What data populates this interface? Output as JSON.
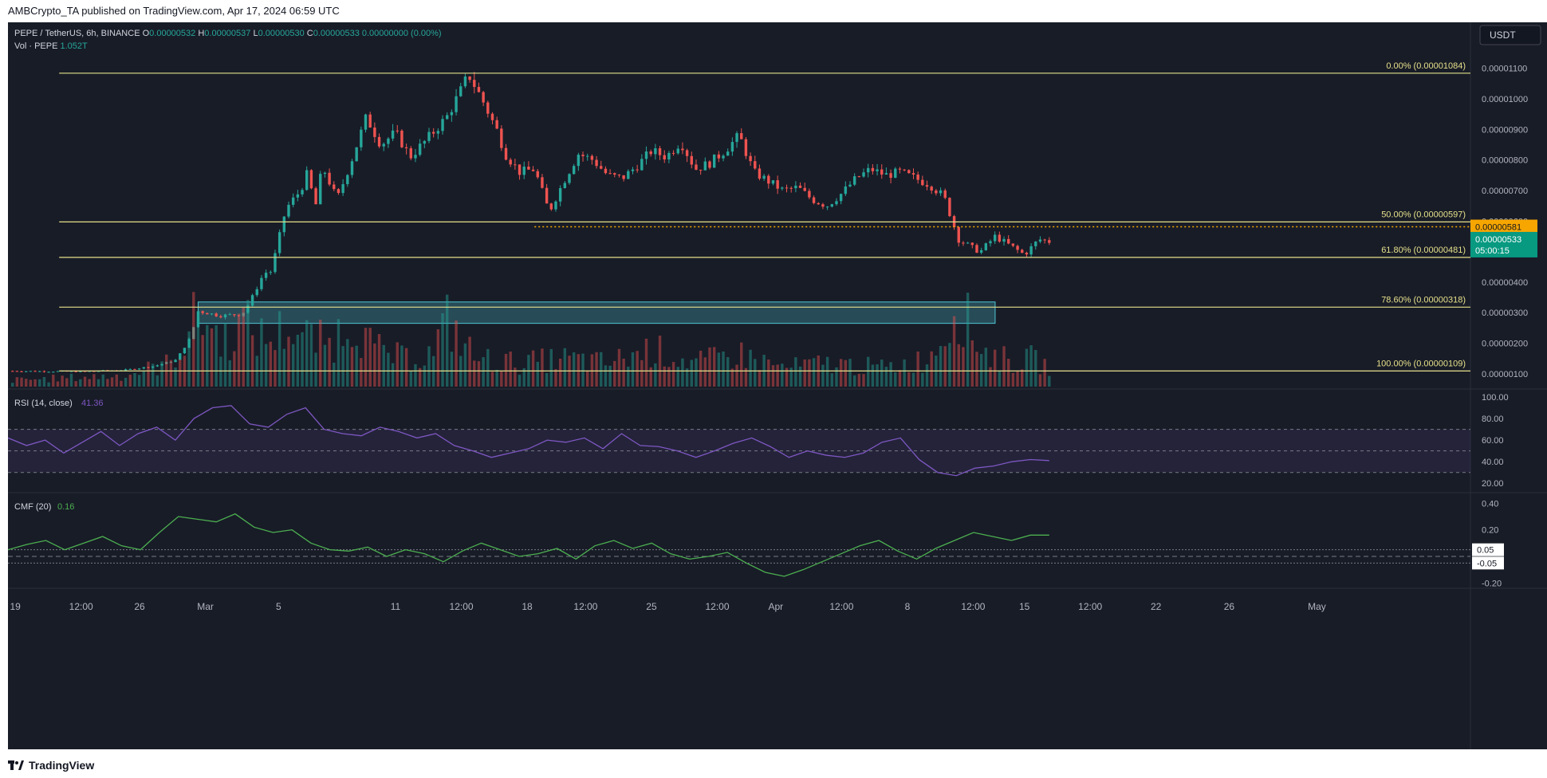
{
  "header": {
    "published": "AMBCrypto_TA published on TradingView.com, Apr 17, 2024 06:59 UTC"
  },
  "footer": {
    "brand": "TradingView"
  },
  "legend": {
    "symbol": "PEPE / TetherUS, 6h, BINANCE",
    "o_label": "O",
    "o": "0.00000532",
    "h_label": "H",
    "h": "0.00000537",
    "l_label": "L",
    "l": "0.00000530",
    "c_label": "C",
    "c": "0.00000533",
    "change": "0.00000000 (0.00%)",
    "vol_label": "Vol · PEPE",
    "vol": "1.052T",
    "currency": "USDT"
  },
  "colors": {
    "bg": "#181c27",
    "up": "#26a69a",
    "down": "#ef5350",
    "up_vol": "#26a69a",
    "down_vol": "#ef5350",
    "fib": "#e6e08a",
    "orange": "#f7a600",
    "rsi": "#7e57c2",
    "cmf": "#4caf50",
    "zone": "#4ec5d4",
    "axis_text": "#b2b5be",
    "price_badge": "#089981"
  },
  "chart_data": [
    {
      "type": "candlestick",
      "title": "PEPE / TetherUS, 6h, BINANCE",
      "xlabels": [
        "19",
        "12:00",
        "26",
        "Mar",
        "5",
        "11",
        "12:00",
        "18",
        "12:00",
        "25",
        "12:00",
        "Apr",
        "12:00",
        "8",
        "12:00",
        "15",
        "12:00",
        "22",
        "26",
        "May"
      ],
      "ylim": [
        5e-07,
        1.12e-05
      ],
      "yticks": [
        "0.00001100",
        "0.00001000",
        "0.00000900",
        "0.00000800",
        "0.00000700",
        "0.00000600",
        "0.00000400",
        "0.00000300",
        "0.00000200",
        "0.00000100"
      ],
      "close_price_tag": "0.00000533",
      "countdown": "05:00:15",
      "resistance_tag": "0.00000581",
      "fib_levels": [
        {
          "label": "0.00% (0.00001084)",
          "value": 1.084e-05
        },
        {
          "label": "50.00% (0.00000597)",
          "value": 5.97e-06
        },
        {
          "label": "61.80% (0.00000481)",
          "value": 4.81e-06
        },
        {
          "label": "78.60% (0.00000318)",
          "value": 3.18e-06
        },
        {
          "label": "100.00% (0.00000109)",
          "value": 1.09e-06
        }
      ],
      "demand_zone": [
        2.65e-06,
        3.35e-06
      ],
      "resistance_line": 5.81e-06,
      "price_path": [
        [
          0,
          1.09
        ],
        [
          0.05,
          1.07
        ],
        [
          0.08,
          1.12
        ],
        [
          0.1,
          1.25
        ],
        [
          0.115,
          1.45
        ],
        [
          0.125,
          2.2
        ],
        [
          0.13,
          3.05
        ],
        [
          0.145,
          2.9
        ],
        [
          0.16,
          2.95
        ],
        [
          0.165,
          3.3
        ],
        [
          0.175,
          4.3
        ],
        [
          0.18,
          4.35
        ],
        [
          0.19,
          6.4
        ],
        [
          0.2,
          7.0
        ],
        [
          0.205,
          7.6
        ],
        [
          0.21,
          6.4
        ],
        [
          0.215,
          7.8
        ],
        [
          0.225,
          6.7
        ],
        [
          0.235,
          8.0
        ],
        [
          0.245,
          9.4
        ],
        [
          0.255,
          8.5
        ],
        [
          0.265,
          8.9
        ],
        [
          0.275,
          8.1
        ],
        [
          0.285,
          8.6
        ],
        [
          0.3,
          9.4
        ],
        [
          0.31,
          10.3
        ],
        [
          0.315,
          10.8
        ],
        [
          0.325,
          9.9
        ],
        [
          0.335,
          8.9
        ],
        [
          0.34,
          8.2
        ],
        [
          0.35,
          7.6
        ],
        [
          0.36,
          7.7
        ],
        [
          0.37,
          6.3
        ],
        [
          0.38,
          7.3
        ],
        [
          0.39,
          8.2
        ],
        [
          0.4,
          8.0
        ],
        [
          0.41,
          7.5
        ],
        [
          0.42,
          7.4
        ],
        [
          0.43,
          7.8
        ],
        [
          0.44,
          8.3
        ],
        [
          0.45,
          8.1
        ],
        [
          0.46,
          8.6
        ],
        [
          0.47,
          7.7
        ],
        [
          0.48,
          7.9
        ],
        [
          0.49,
          8.3
        ],
        [
          0.5,
          8.8
        ],
        [
          0.51,
          7.6
        ],
        [
          0.52,
          7.3
        ],
        [
          0.53,
          7.0
        ],
        [
          0.54,
          7.1
        ],
        [
          0.55,
          6.7
        ],
        [
          0.56,
          6.5
        ],
        [
          0.57,
          6.9
        ],
        [
          0.58,
          7.4
        ],
        [
          0.59,
          7.7
        ],
        [
          0.6,
          7.5
        ],
        [
          0.61,
          7.6
        ],
        [
          0.62,
          7.4
        ],
        [
          0.63,
          7.2
        ],
        [
          0.64,
          6.8
        ],
        [
          0.65,
          5.4
        ],
        [
          0.66,
          5.1
        ],
        [
          0.665,
          5.0
        ],
        [
          0.675,
          5.5
        ],
        [
          0.685,
          5.2
        ],
        [
          0.695,
          4.9
        ],
        [
          0.705,
          5.4
        ],
        [
          0.712,
          5.33
        ]
      ],
      "volume_path": [
        [
          0.02,
          0.08
        ],
        [
          0.05,
          0.1
        ],
        [
          0.08,
          0.12
        ],
        [
          0.11,
          0.25
        ],
        [
          0.12,
          0.45
        ],
        [
          0.13,
          0.8
        ],
        [
          0.14,
          0.6
        ],
        [
          0.15,
          0.5
        ],
        [
          0.16,
          0.7
        ],
        [
          0.17,
          0.55
        ],
        [
          0.18,
          0.5
        ],
        [
          0.19,
          0.65
        ],
        [
          0.2,
          0.55
        ],
        [
          0.22,
          0.45
        ],
        [
          0.235,
          0.75
        ],
        [
          0.25,
          0.4
        ],
        [
          0.27,
          0.3
        ],
        [
          0.29,
          0.35
        ],
        [
          0.3,
          0.7
        ],
        [
          0.32,
          0.3
        ],
        [
          0.35,
          0.25
        ],
        [
          0.38,
          0.3
        ],
        [
          0.41,
          0.25
        ],
        [
          0.44,
          0.4
        ],
        [
          0.47,
          0.25
        ],
        [
          0.5,
          0.35
        ],
        [
          0.53,
          0.2
        ],
        [
          0.56,
          0.25
        ],
        [
          0.6,
          0.2
        ],
        [
          0.63,
          0.3
        ],
        [
          0.65,
          0.9
        ],
        [
          0.66,
          0.55
        ],
        [
          0.67,
          0.35
        ],
        [
          0.69,
          0.25
        ],
        [
          0.7,
          0.3
        ],
        [
          0.712,
          0.2
        ]
      ]
    },
    {
      "type": "line",
      "title": "RSI (14, close)",
      "value": "41.36",
      "yticks": [
        "100.00",
        "80.00",
        "60.00",
        "40.00",
        "20.00"
      ],
      "ylim": [
        15,
        100
      ],
      "bands": [
        30,
        50,
        70
      ],
      "series": [
        {
          "values": [
            62,
            55,
            60,
            48,
            58,
            68,
            55,
            66,
            72,
            60,
            80,
            90,
            92,
            75,
            72,
            84,
            90,
            70,
            66,
            64,
            72,
            68,
            62,
            66,
            55,
            50,
            44,
            48,
            52,
            60,
            58,
            62,
            52,
            66,
            55,
            54,
            50,
            44,
            50,
            57,
            62,
            54,
            44,
            50,
            46,
            44,
            48,
            58,
            62,
            42,
            30,
            27,
            34,
            36,
            40,
            42,
            41
          ]
        }
      ]
    },
    {
      "type": "line",
      "title": "CMF (20)",
      "value": "0.16",
      "yticks": [
        "0.40",
        "0.20",
        "0.05",
        "-0.05",
        "-0.20"
      ],
      "ylim": [
        -0.24,
        0.42
      ],
      "bands": [
        0.05,
        0,
        -0.05
      ],
      "series": [
        {
          "values": [
            0.05,
            0.09,
            0.12,
            0.05,
            0.1,
            0.15,
            0.08,
            0.05,
            0.18,
            0.3,
            0.28,
            0.26,
            0.32,
            0.22,
            0.18,
            0.2,
            0.1,
            0.05,
            0.04,
            0.07,
            0.0,
            0.05,
            0.02,
            -0.04,
            0.04,
            0.1,
            0.05,
            0.0,
            0.02,
            0.06,
            -0.02,
            0.08,
            0.12,
            0.06,
            0.1,
            0.02,
            -0.02,
            0.0,
            0.03,
            -0.05,
            -0.12,
            -0.15,
            -0.1,
            -0.04,
            0.02,
            0.08,
            0.12,
            0.04,
            -0.02,
            0.06,
            0.12,
            0.18,
            0.15,
            0.12,
            0.16,
            0.16
          ]
        }
      ]
    }
  ]
}
